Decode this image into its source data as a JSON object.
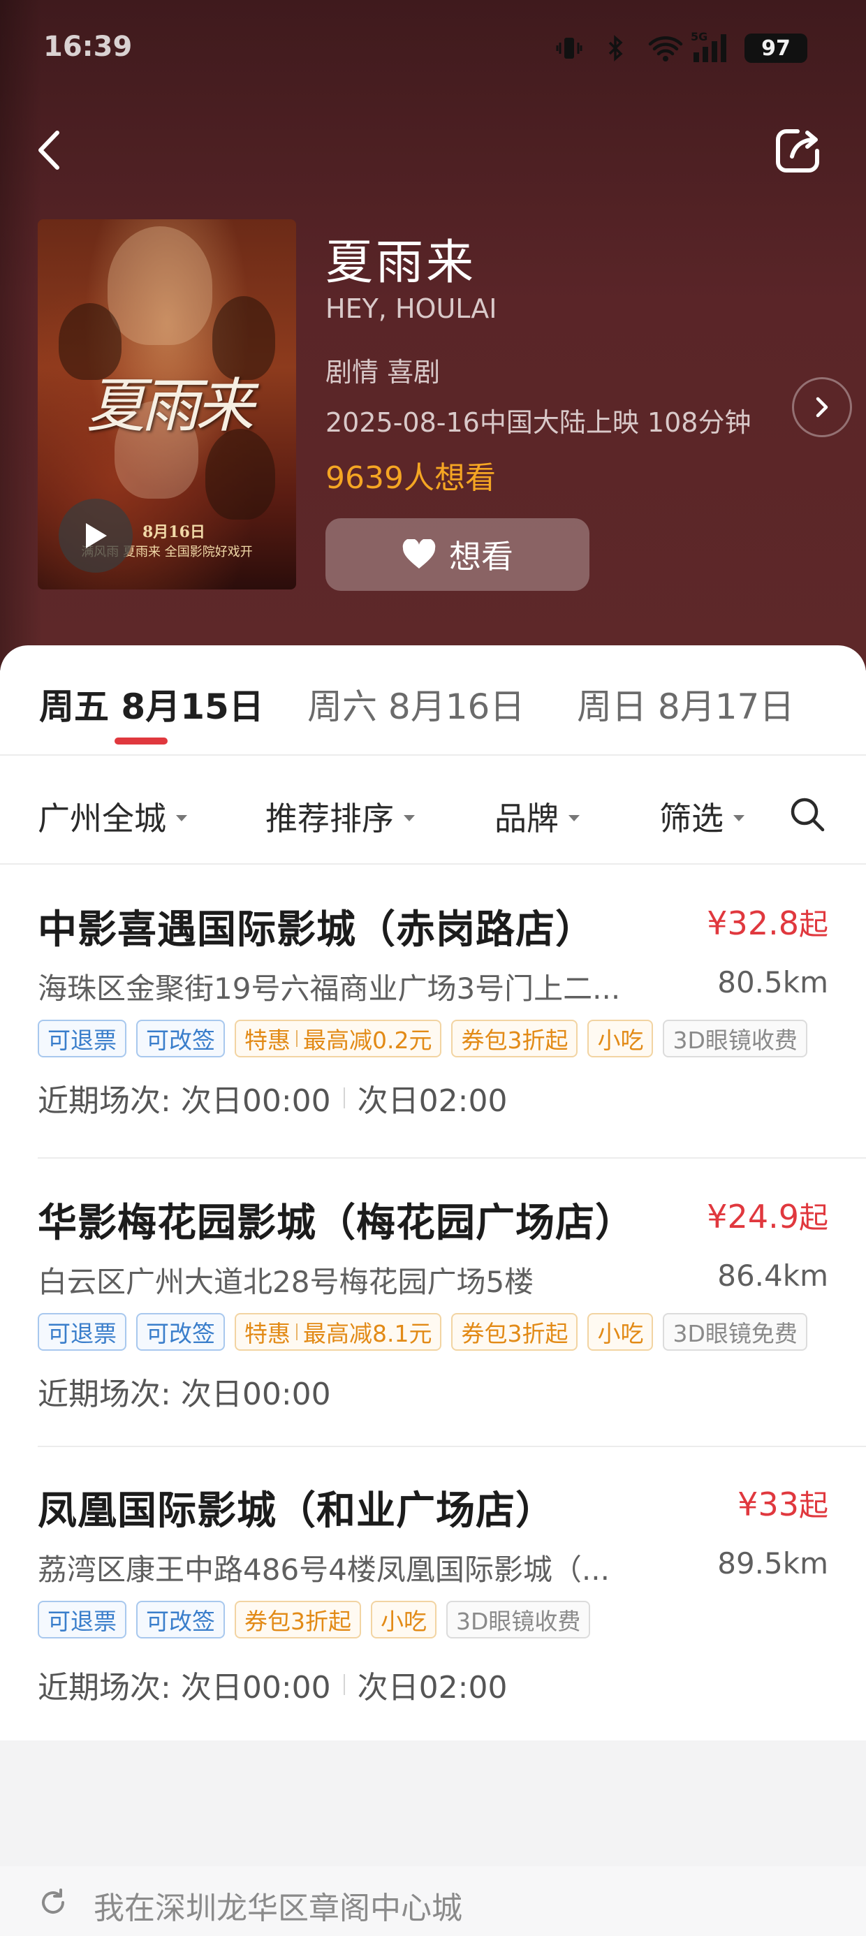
{
  "status_bar": {
    "time": "16:39",
    "battery": "97",
    "network": "5G"
  },
  "movie": {
    "title": "夏雨来",
    "title_en": "HEY, HOULAI",
    "genres": "剧情 喜剧",
    "release": "2025-08-16中国大陆上映 108分钟",
    "want_count": "9639人想看",
    "want_button": "想看",
    "poster": {
      "title": "夏雨来",
      "date": "8月16日",
      "subtitle": "满风雨 夏雨来 全国影院好戏开"
    }
  },
  "date_tabs": [
    {
      "label": "周五 8月15日",
      "active": true
    },
    {
      "label": "周六 8月16日",
      "active": false
    },
    {
      "label": "周日 8月17日",
      "active": false
    }
  ],
  "filters": [
    "广州全城",
    "推荐排序",
    "品牌",
    "筛选"
  ],
  "cinemas": [
    {
      "name": "中影喜遇国际影城（赤岗路店）",
      "price": "¥32.8",
      "price_suffix": "起",
      "address": "海珠区金聚街19号六福商业广场3号门上二...",
      "distance": "80.5km",
      "tags": [
        {
          "text": "可退票",
          "style": "blue"
        },
        {
          "text": "可改签",
          "style": "blue"
        },
        {
          "text": "特惠",
          "text2": "最高减0.2元",
          "style": "orange"
        },
        {
          "text": "券包3折起",
          "style": "orange"
        },
        {
          "text": "小吃",
          "style": "orange"
        },
        {
          "text": "3D眼镜收费",
          "style": "gray"
        }
      ],
      "shows_label": "近期场次:",
      "shows": [
        "次日00:00",
        "次日02:00"
      ]
    },
    {
      "name": "华影梅花园影城（梅花园广场店）",
      "price": "¥24.9",
      "price_suffix": "起",
      "address": "白云区广州大道北28号梅花园广场5楼",
      "distance": "86.4km",
      "tags": [
        {
          "text": "可退票",
          "style": "blue"
        },
        {
          "text": "可改签",
          "style": "blue"
        },
        {
          "text": "特惠",
          "text2": "最高减8.1元",
          "style": "orange"
        },
        {
          "text": "券包3折起",
          "style": "orange"
        },
        {
          "text": "小吃",
          "style": "orange"
        },
        {
          "text": "3D眼镜免费",
          "style": "gray"
        }
      ],
      "shows_label": "近期场次:",
      "shows": [
        "次日00:00"
      ]
    },
    {
      "name": "凤凰国际影城（和业广场店）",
      "price": "¥33",
      "price_suffix": "起",
      "address": "荔湾区康王中路486号4楼凤凰国际影城（...",
      "distance": "89.5km",
      "tags": [
        {
          "text": "可退票",
          "style": "blue"
        },
        {
          "text": "可改签",
          "style": "blue"
        },
        {
          "text": "券包3折起",
          "style": "orange"
        },
        {
          "text": "小吃",
          "style": "orange"
        },
        {
          "text": "3D眼镜收费",
          "style": "gray"
        }
      ],
      "shows_label": "近期场次:",
      "shows": [
        "次日00:00",
        "次日02:00"
      ]
    }
  ],
  "location": {
    "text": "我在深圳龙华区章阁中心城"
  },
  "colors": {
    "accent": "#e0383e",
    "want": "#f5a623",
    "hero_bg": "#5a2528"
  }
}
